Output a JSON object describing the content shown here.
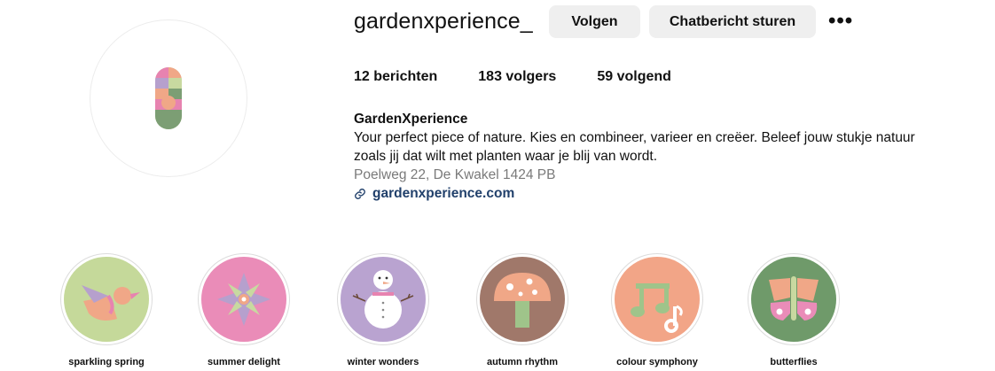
{
  "profile": {
    "username": "gardenxperience_",
    "follow_label": "Volgen",
    "message_label": "Chatbericht sturen",
    "more_label": "•••",
    "avatar_icon": "striped-pill-logo-icon"
  },
  "stats": {
    "posts": "12 berichten",
    "followers": "183 volgers",
    "following": "59 volgend"
  },
  "bio": {
    "name": "GardenXperience",
    "line1": "Your perfect piece of nature. Kies en combineer, varieer en creëer. Beleef jouw stukje natuur",
    "line2": "zoals jij dat wilt met planten waar je blij van wordt.",
    "address": "Poelweg 22, De Kwakel 1424 PB",
    "link": "gardenxperience.com",
    "link_icon": "link-icon"
  },
  "highlights": [
    {
      "label": "sparkling spring",
      "icon": "bird-icon",
      "bg": "#c5d99a"
    },
    {
      "label": "summer delight",
      "icon": "flower-icon",
      "bg": "#ea8cb8"
    },
    {
      "label": "winter wonders",
      "icon": "snowman-icon",
      "bg": "#b9a3d0"
    },
    {
      "label": "autumn rhythm",
      "icon": "mushroom-icon",
      "bg": "#a0786a"
    },
    {
      "label": "colour symphony",
      "icon": "music-note-icon",
      "bg": "#f2a587"
    },
    {
      "label": "butterflies",
      "icon": "butterfly-icon",
      "bg": "#6f9a6a"
    }
  ],
  "colors": {
    "button_bg": "#efefef",
    "link": "#21406b",
    "address": "#7a7a7a"
  }
}
